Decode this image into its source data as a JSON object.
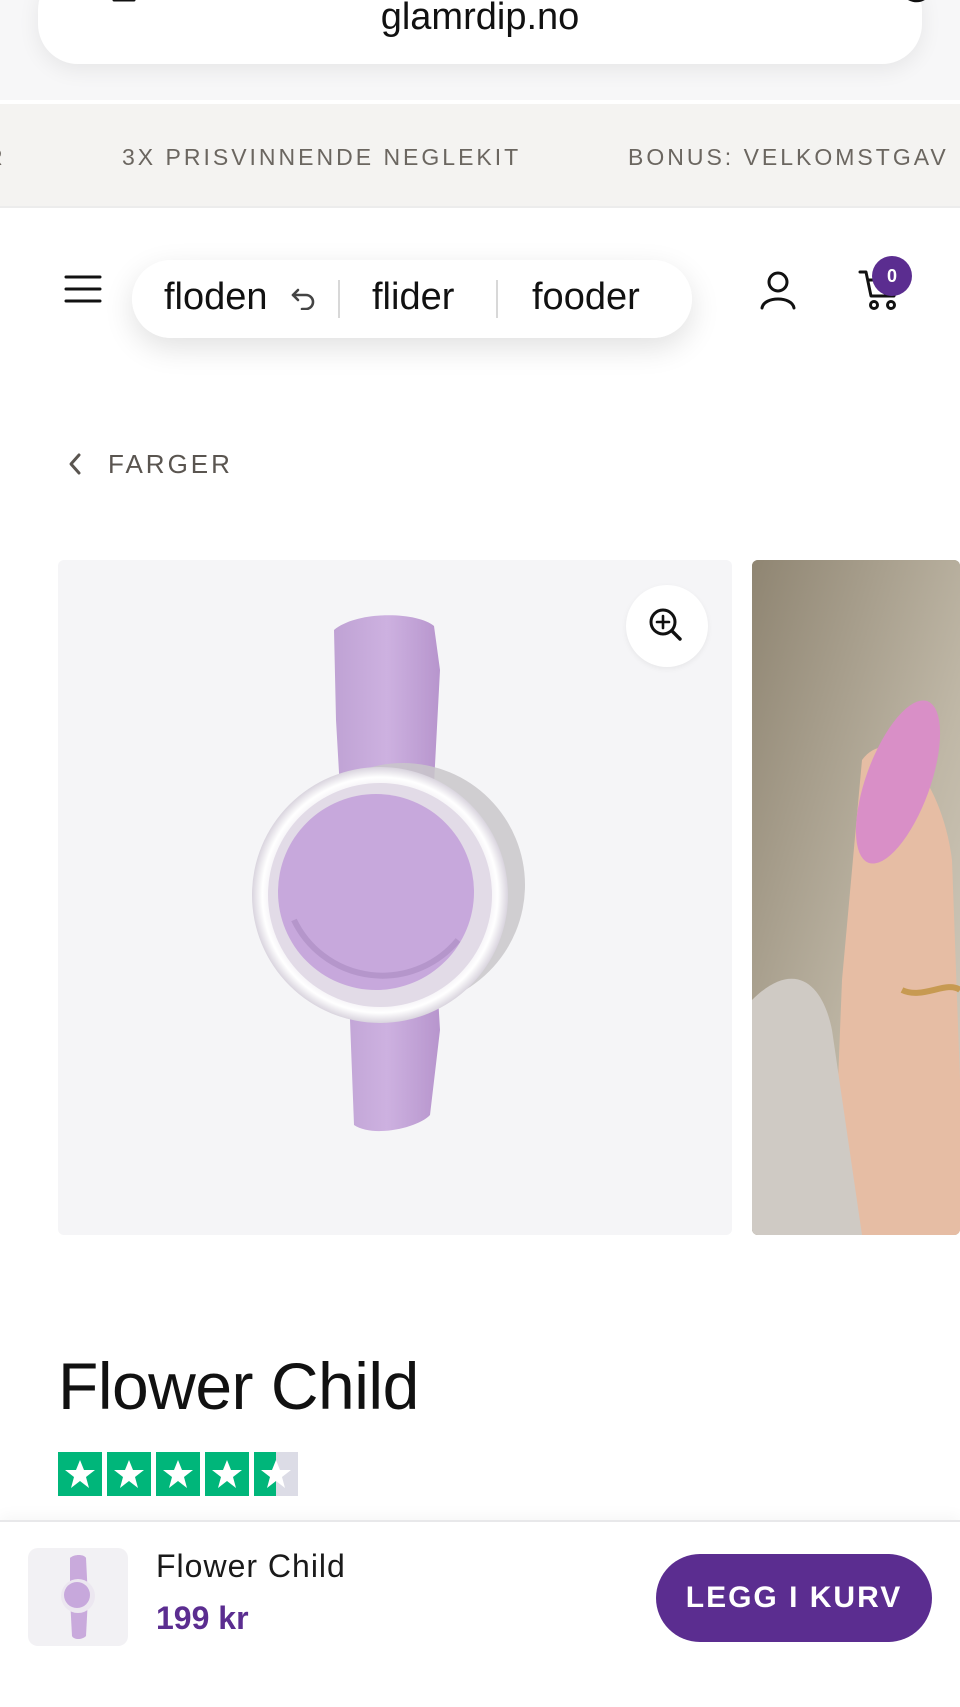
{
  "browser": {
    "url": "glamrdip.no"
  },
  "banner": {
    "items": [
      "3X PRISVINNENDE NEGLEKIT",
      "BONUS: VELKOMSTGAV"
    ]
  },
  "header": {
    "cart_count": "0"
  },
  "keyboard_suggestions": {
    "words": [
      "floden",
      "flider",
      "fooder"
    ]
  },
  "breadcrumb": {
    "label": "FARGER"
  },
  "product": {
    "title": "Flower Child",
    "rating_stars": 4.5,
    "rating_max": 5
  },
  "sticky_bar": {
    "name": "Flower Child",
    "price": "199 kr",
    "cta": "LEGG I KURV"
  },
  "colors": {
    "brand_purple": "#5b2d90",
    "trustpilot_green": "#00b67a",
    "product_lilac": "#c7a8dc"
  }
}
